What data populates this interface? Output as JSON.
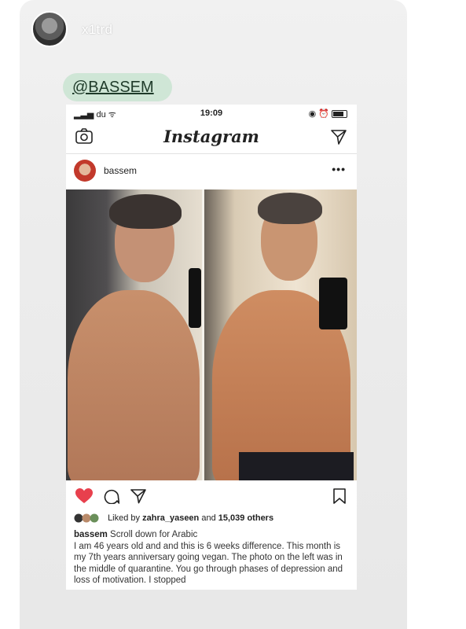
{
  "story": {
    "username": "x1trd",
    "mention": "@BASSEM"
  },
  "statusbar": {
    "carrier": "du",
    "time": "19:09"
  },
  "instagram": {
    "logo": "Instagram"
  },
  "post": {
    "username": "bassem",
    "more": "•••",
    "likes_prefix": "Liked by",
    "likes_user": "zahra_yaseen",
    "likes_and": "and",
    "likes_count": "15,039 others",
    "caption_user": "bassem",
    "caption_first": "Scroll down for Arabic",
    "caption_body": "I am 46 years old and and this is 6 weeks difference. This month is my 7th years anniversary going vegan. The photo on the left was in the middle of quarantine. You go through phases of depression and loss of motivation. I stopped"
  },
  "colors": {
    "heart": "#e8404d",
    "mention_bg": "#cfe6d6"
  },
  "icons": [
    "camera-icon",
    "send-icon",
    "more-icon",
    "heart-icon",
    "comment-icon",
    "share-icon",
    "bookmark-icon"
  ]
}
